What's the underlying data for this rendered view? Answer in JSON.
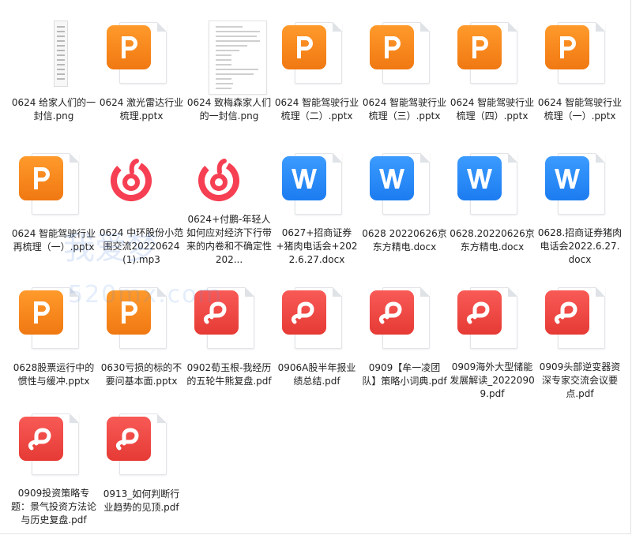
{
  "colors": {
    "ppt": "#f5821f",
    "docx": "#2a86f6",
    "pdf": "#ee4743",
    "mp3": "#f63f52"
  },
  "watermark": {
    "text_cn": "我爱梦",
    "text_url": "520mx.com"
  },
  "files": [
    {
      "name": "0624 给家人们的一封信.png",
      "type": "png",
      "icon": "png-narrow-thumbnail"
    },
    {
      "name": "0624 激光雷达行业梳理.pptx",
      "type": "pptx",
      "icon": "ppt-icon"
    },
    {
      "name": "0624 致梅森家人们的一封信.png",
      "type": "png",
      "icon": "png-letter-thumbnail"
    },
    {
      "name": "0624 智能驾驶行业梳理（二）.pptx",
      "type": "pptx",
      "icon": "ppt-icon"
    },
    {
      "name": "0624 智能驾驶行业梳理（三）.pptx",
      "type": "pptx",
      "icon": "ppt-icon"
    },
    {
      "name": "0624 智能驾驶行业梳理（四）.pptx",
      "type": "pptx",
      "icon": "ppt-icon"
    },
    {
      "name": "0624 智能驾驶行业梳理（一）.pptx",
      "type": "pptx",
      "icon": "ppt-icon"
    },
    {
      "name": "0624 智能驾驶行业再梳理（一）.pptx",
      "type": "pptx",
      "icon": "ppt-icon"
    },
    {
      "name": "0624 中环股份小范围交流20220624(1).mp3",
      "type": "mp3",
      "icon": "netease-music-icon"
    },
    {
      "name": "0624+付鹏-年轻人如何应对经济下行带来的内卷和不确定性202...",
      "type": "mp3",
      "icon": "netease-music-icon"
    },
    {
      "name": "0627+招商证券+猪肉电话会+2022.6.27.docx",
      "type": "docx",
      "icon": "word-icon"
    },
    {
      "name": "0628 20220626京东方精电.docx",
      "type": "docx",
      "icon": "word-icon"
    },
    {
      "name": "0628.20220626京东方精电.docx",
      "type": "docx",
      "icon": "word-icon"
    },
    {
      "name": "0628.招商证券猪肉电话会2022.6.27.docx",
      "type": "docx",
      "icon": "word-icon"
    },
    {
      "name": "0628股票运行中的惯性与缓冲.pptx",
      "type": "pptx",
      "icon": "ppt-icon"
    },
    {
      "name": "0630亏损的标的不要问基本面.pptx",
      "type": "pptx",
      "icon": "ppt-icon"
    },
    {
      "name": "0902荀玉根-我经历的五轮牛熊复盘.pdf",
      "type": "pdf",
      "icon": "pdf-icon"
    },
    {
      "name": "0906A股半年报业绩总结.pdf",
      "type": "pdf",
      "icon": "pdf-icon"
    },
    {
      "name": "0909【牟一凌团队】策略小词典.pdf",
      "type": "pdf",
      "icon": "pdf-icon"
    },
    {
      "name": "0909海外大型储能发展解读_20220909.pdf",
      "type": "pdf",
      "icon": "pdf-icon"
    },
    {
      "name": "0909头部逆变器资深专家交流会议要点.pdf",
      "type": "pdf",
      "icon": "pdf-icon"
    },
    {
      "name": "0909投资策略专题：景气投资方法论与历史复盘.pdf",
      "type": "pdf",
      "icon": "pdf-icon"
    },
    {
      "name": "0913_如何判断行业趋势的见顶.pdf",
      "type": "pdf",
      "icon": "pdf-icon"
    }
  ]
}
